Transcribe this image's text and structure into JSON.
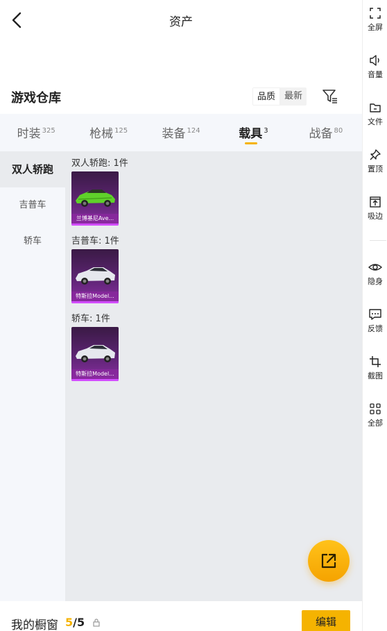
{
  "header": {
    "title": "资产"
  },
  "warehouse": {
    "title": "游戏仓库",
    "sort_options": [
      "品质",
      "最新"
    ],
    "sort_active": 0
  },
  "tabs": [
    {
      "label": "时装",
      "count": "325"
    },
    {
      "label": "枪械",
      "count": "125"
    },
    {
      "label": "装备",
      "count": "124"
    },
    {
      "label": "载具",
      "count": "3"
    },
    {
      "label": "战备",
      "count": "80"
    }
  ],
  "active_tab": 3,
  "side_categories": [
    "双人轿跑",
    "吉普车",
    "轿车"
  ],
  "groups": [
    {
      "title": "双人轿跑: 1件",
      "items": [
        {
          "name": "兰博基尼Ave...",
          "car_color": "#5fd12a"
        }
      ]
    },
    {
      "title": "吉普车: 1件",
      "items": [
        {
          "name": "特斯拉Model...",
          "car_color": "#e6e8ee"
        }
      ]
    },
    {
      "title": "轿车: 1件",
      "items": [
        {
          "name": "特斯拉Model...",
          "car_color": "#e6e8ee"
        }
      ]
    }
  ],
  "bottom": {
    "showcase_label": "我的橱窗",
    "showcase_current": "5",
    "showcase_total": "/5",
    "edit_label": "编辑"
  },
  "toolbar": [
    {
      "label": "全屏",
      "icon": "fullscreen-icon"
    },
    {
      "label": "音量",
      "icon": "volume-icon"
    },
    {
      "label": "文件",
      "icon": "folder-icon"
    },
    {
      "label": "置顶",
      "icon": "pin-icon"
    },
    {
      "label": "吸边",
      "icon": "dock-edge-icon"
    },
    {
      "label": "隐身",
      "icon": "eye-icon"
    },
    {
      "label": "反馈",
      "icon": "feedback-icon"
    },
    {
      "label": "截图",
      "icon": "crop-icon"
    },
    {
      "label": "全部",
      "icon": "grid-icon"
    }
  ],
  "colors": {
    "accent": "#f5b301",
    "card_purple": "#8a2fa3"
  }
}
